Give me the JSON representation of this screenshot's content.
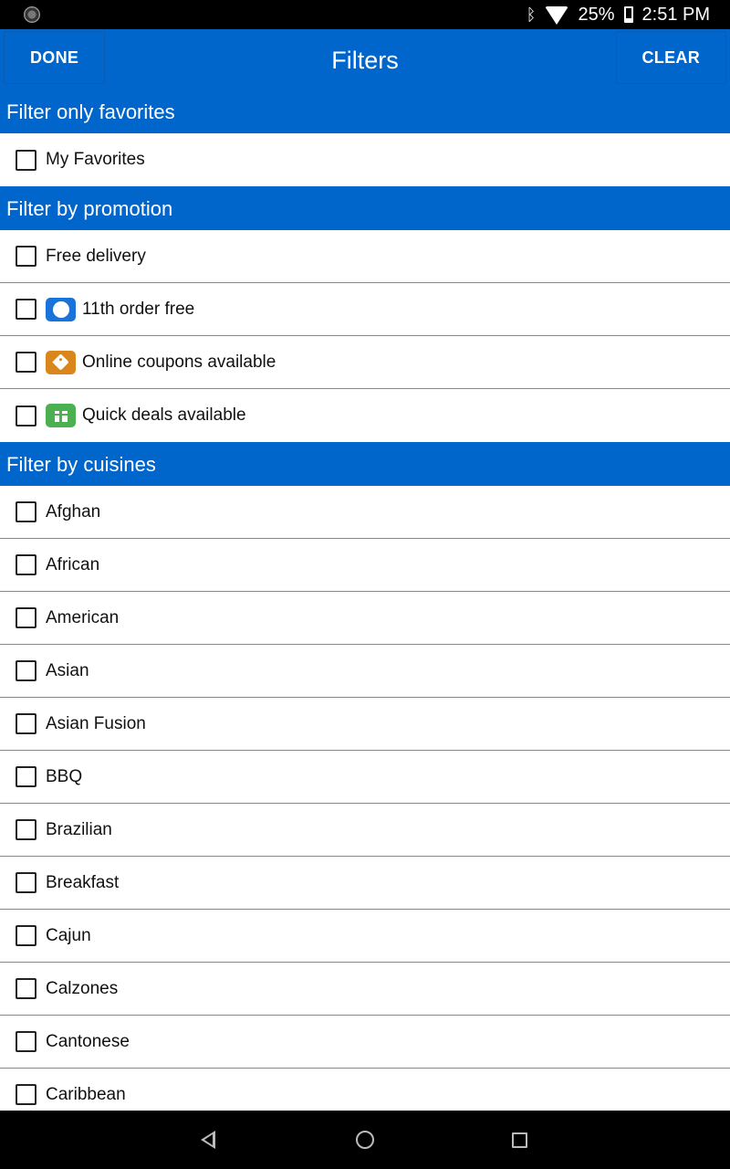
{
  "status_bar": {
    "battery": "25%",
    "time": "2:51 PM",
    "icons": [
      "camera-icon",
      "bluetooth-icon",
      "wifi-icon",
      "battery-icon"
    ]
  },
  "app_bar": {
    "done_label": "DONE",
    "title": "Filters",
    "clear_label": "CLEAR",
    "background": "#0066cc"
  },
  "sections": {
    "favorites": {
      "header": "Filter only favorites",
      "items": [
        "My Favorites"
      ]
    },
    "promotion": {
      "header": "Filter by promotion",
      "items": [
        {
          "label": "Free delivery",
          "icon": null
        },
        {
          "label": "11th order free",
          "icon": "badge-seal-icon",
          "color": "#1a73d9"
        },
        {
          "label": "Online coupons available",
          "icon": "tag-icon",
          "color": "#d9861c"
        },
        {
          "label": "Quick deals available",
          "icon": "gift-icon",
          "color": "#4caf50"
        }
      ]
    },
    "cuisines": {
      "header": "Filter by cuisines",
      "items": [
        "Afghan",
        "African",
        "American",
        "Asian",
        "Asian Fusion",
        "BBQ",
        "Brazilian",
        "Breakfast",
        "Cajun",
        "Calzones",
        "Cantonese",
        "Caribbean"
      ]
    }
  },
  "nav_bar": {
    "icons": [
      "back-icon",
      "home-icon",
      "recent-apps-icon"
    ]
  }
}
